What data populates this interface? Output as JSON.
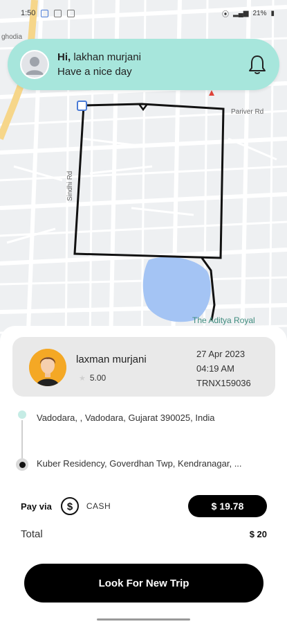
{
  "status_bar": {
    "time": "1:50",
    "battery": "21%"
  },
  "greeting": {
    "hi": "Hi,",
    "name": "lakhan murjani",
    "subtitle": "Have a nice day"
  },
  "map": {
    "labels": [
      "ghodia",
      "Pariver Rd",
      "Sindhi Rd",
      "The Aditya Royal"
    ],
    "water_color": "#a4c4f4"
  },
  "trip": {
    "driver_name": "laxman murjani",
    "rating": "5.00",
    "date": "27 Apr 2023",
    "time": "04:19 AM",
    "transaction_id": "TRNX159036",
    "from": "Vadodara, , Vadodara, Gujarat 390025, India",
    "to": "Kuber Residency, Goverdhan Twp, Kendranagar, ..."
  },
  "payment": {
    "label": "Pay via",
    "method": "CASH",
    "amount": "$ 19.78",
    "total_label": "Total",
    "total_value": "$ 20"
  },
  "cta_label": "Look For New Trip",
  "colors": {
    "accent": "#a7e6dc",
    "primary": "#000000",
    "card_bg": "#e9e9e9"
  }
}
